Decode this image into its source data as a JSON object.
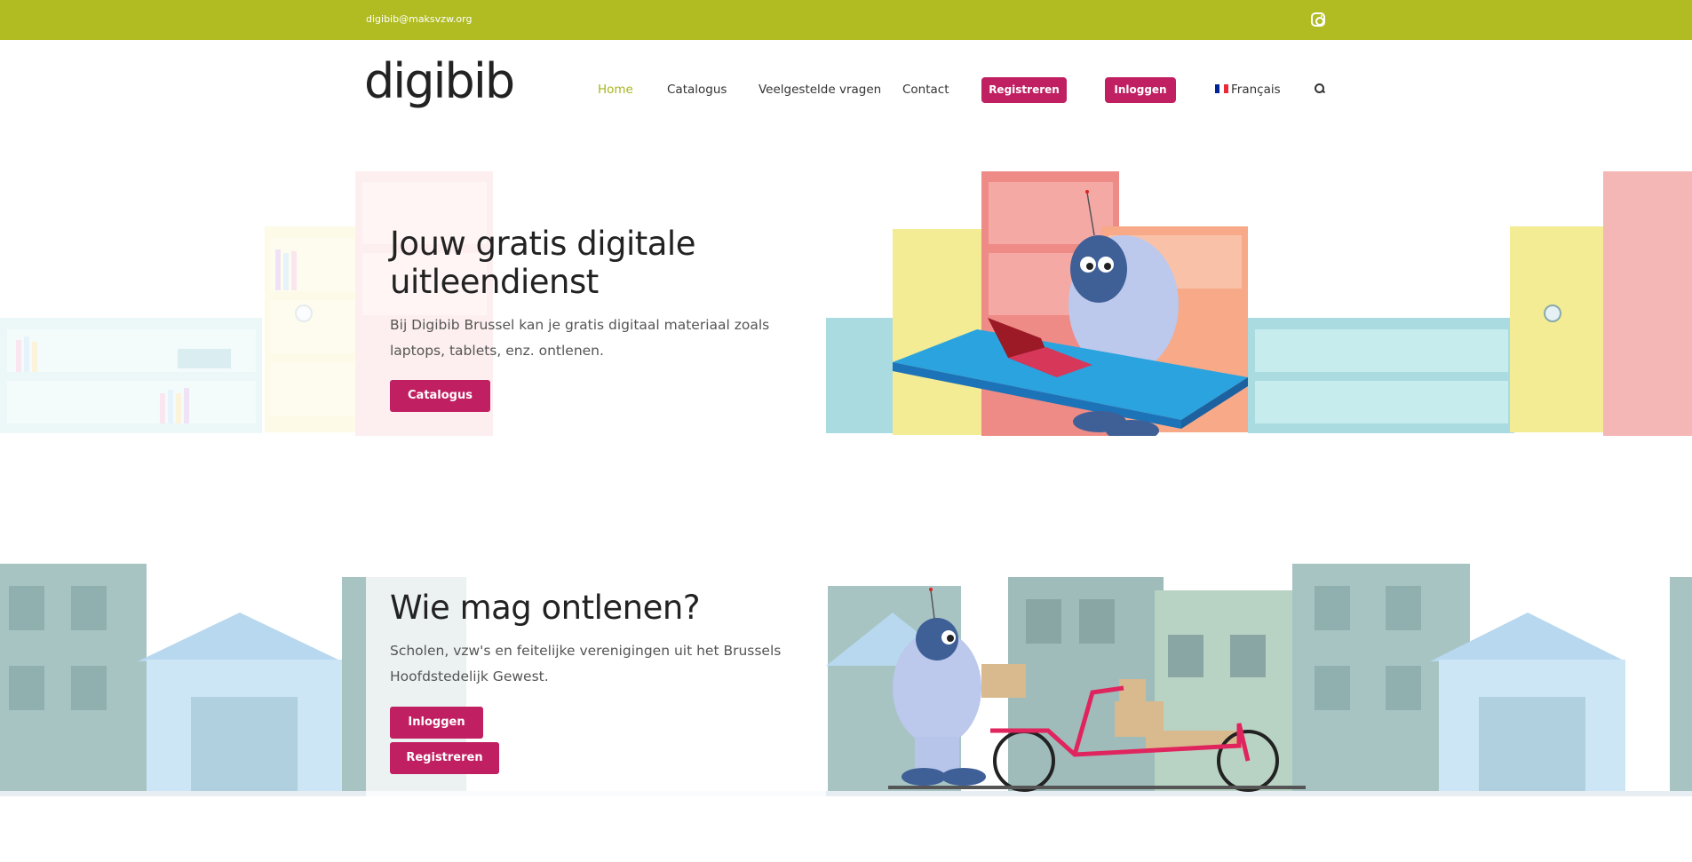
{
  "topbar": {
    "email": "digibib@maksvzw.org",
    "social_icon": "instagram-icon",
    "color": "#b0bc22"
  },
  "header": {
    "logo": "digibib",
    "nav": {
      "home": "Home",
      "catalogus": "Catalogus",
      "faq": "Veelgestelde vragen",
      "contact": "Contact"
    },
    "register_label": "Registreren",
    "login_label": "Inloggen",
    "language_label": "Français",
    "language_flag": "flag-fr-icon",
    "search_icon": "search-icon",
    "active_color": "#a8b51e",
    "accent_color": "#c01f62"
  },
  "hero": {
    "title": "Jouw gratis digitale uitleendienst",
    "title_line1": "Jouw gratis digitale",
    "title_line2": "uitleendienst",
    "text_line1": "Bij Digibib Brussel kan je gratis digitaal materiaal zoals",
    "text_line2": "laptops, tablets, enz. ontlenen.",
    "cta_label": "Catalogus"
  },
  "eligibility": {
    "title": "Wie mag ontlenen?",
    "text_line1": "Scholen, vzw's en feitelijke verenigingen uit het Brussels",
    "text_line2": "Hoofdstedelijk Gewest.",
    "login_label": "Inloggen",
    "register_label": "Registreren"
  }
}
